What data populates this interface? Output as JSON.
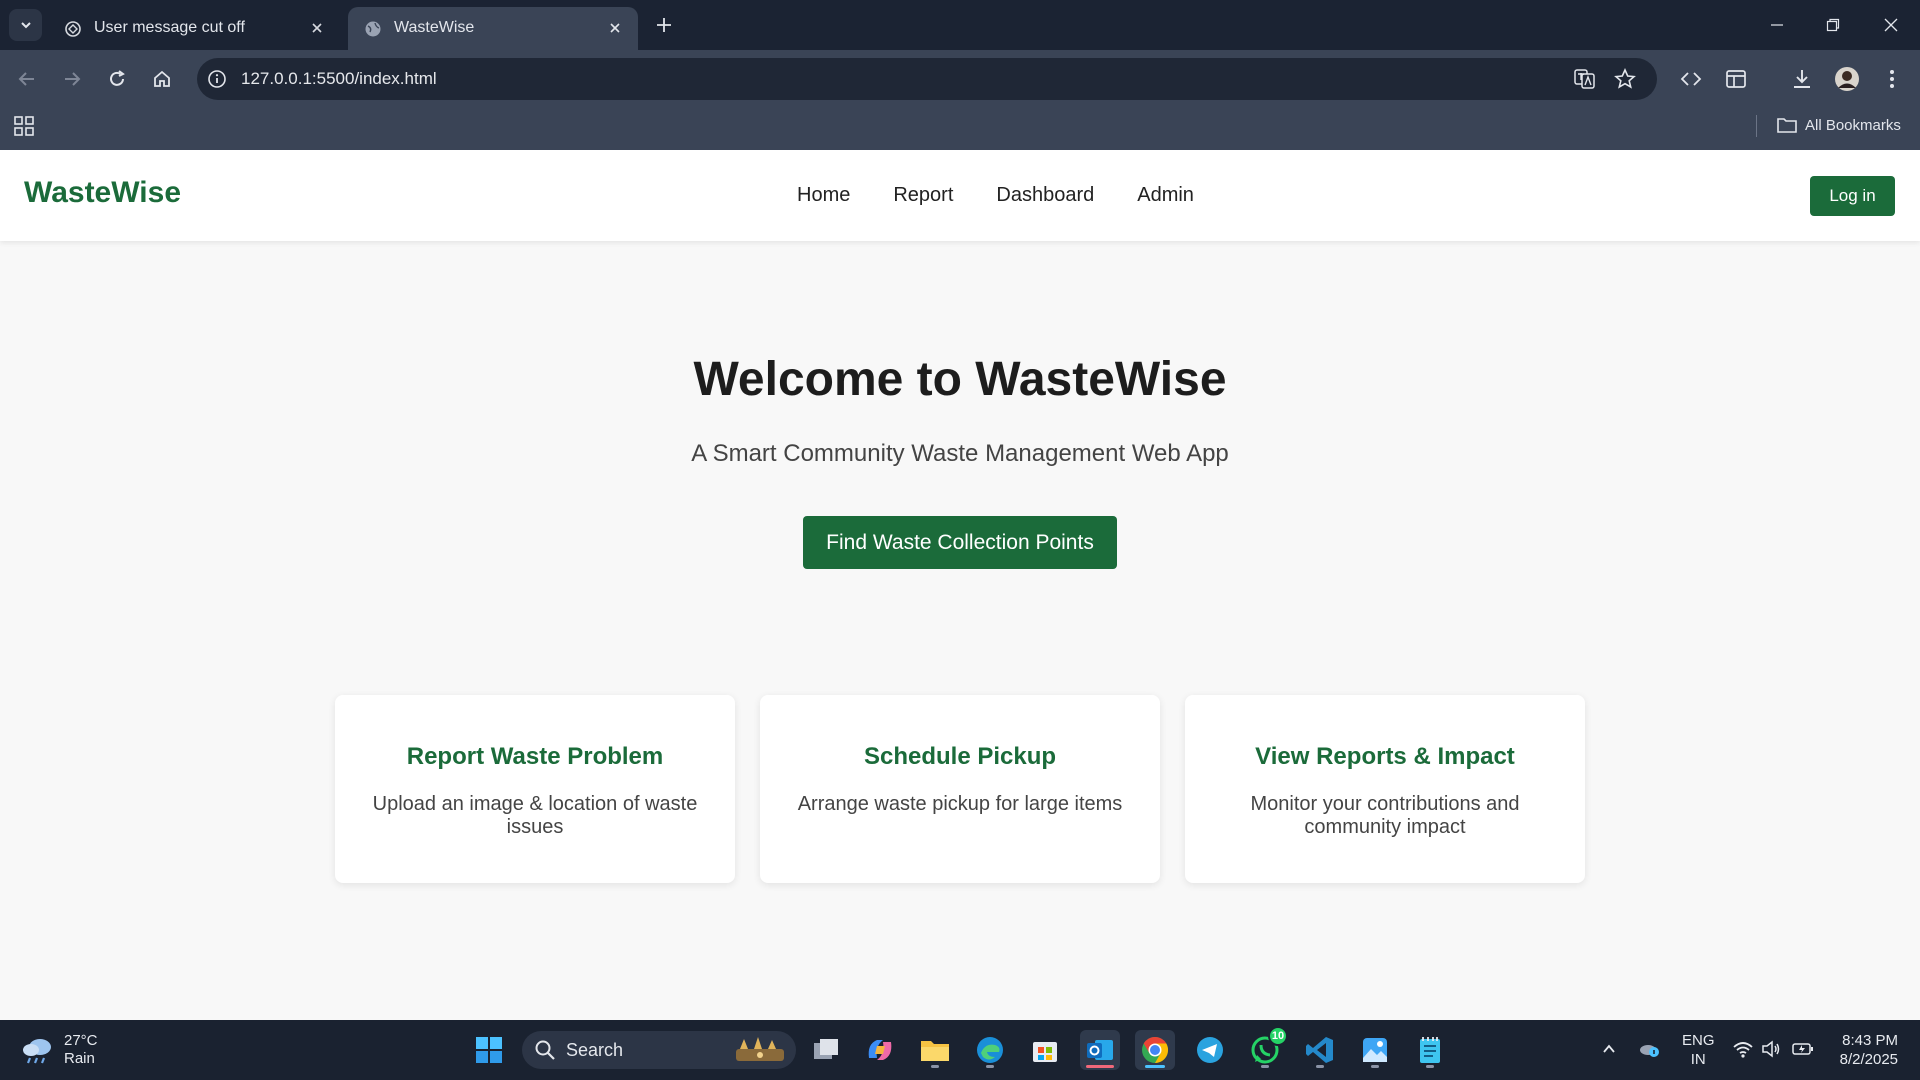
{
  "browser": {
    "tabs": [
      {
        "title": "User message cut off",
        "active": false
      },
      {
        "title": "WasteWise",
        "active": true
      }
    ],
    "url": "127.0.0.1:5500/index.html",
    "bookmarks_label": "All Bookmarks"
  },
  "site": {
    "logo": "WasteWise",
    "nav": [
      "Home",
      "Report",
      "Dashboard",
      "Admin"
    ],
    "login_label": "Log in",
    "hero": {
      "title": "Welcome to WasteWise",
      "subtitle": "A Smart Community Waste Management Web App",
      "cta_label": "Find Waste Collection Points"
    },
    "cards": [
      {
        "title": "Report Waste Problem",
        "text": "Upload an image & location of waste issues"
      },
      {
        "title": "Schedule Pickup",
        "text": "Arrange waste pickup for large items"
      },
      {
        "title": "View Reports & Impact",
        "text": "Monitor your contributions and community impact"
      }
    ],
    "colors": {
      "brand": "#1b6b3a",
      "background": "#f8f8f8"
    }
  },
  "taskbar": {
    "weather_temp": "27°C",
    "weather_cond": "Rain",
    "search_label": "Search",
    "whatsapp_badge": "10",
    "lang_line1": "ENG",
    "lang_line2": "IN",
    "time": "8:43 PM",
    "date": "8/2/2025"
  }
}
